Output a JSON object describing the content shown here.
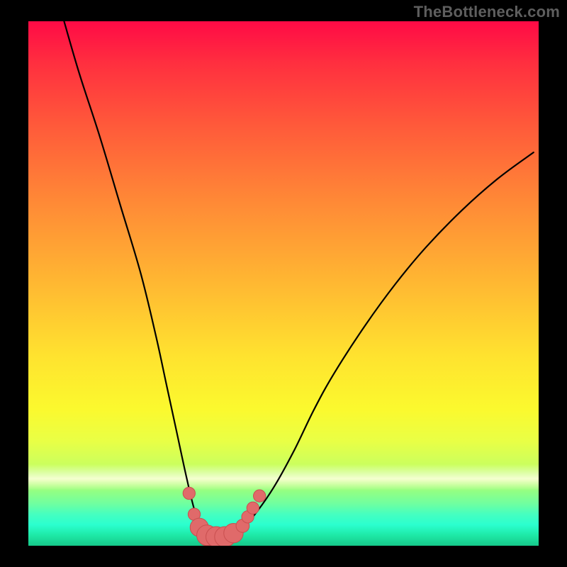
{
  "watermark": {
    "text": "TheBottleneck.com"
  },
  "colors": {
    "curve_stroke": "#000000",
    "marker_fill": "#e06a6a",
    "marker_stroke": "#c94f4f",
    "near_bottom_band": "#f5ffd0"
  },
  "chart_data": {
    "type": "line",
    "title": "",
    "xlabel": "",
    "ylabel": "",
    "xlim": [
      0,
      100
    ],
    "ylim": [
      0,
      100
    ],
    "grid": false,
    "legend": false,
    "series": [
      {
        "name": "bottleneck-curve",
        "x": [
          7,
          10,
          14,
          18,
          22,
          25,
          27,
          29,
          31,
          32.5,
          34,
          36,
          38.5,
          41,
          44,
          48,
          52,
          56,
          60,
          66,
          72,
          78,
          85,
          92,
          99
        ],
        "y": [
          100,
          90,
          78,
          65,
          52,
          40,
          31,
          22,
          13,
          7,
          3,
          1.5,
          1.5,
          2.5,
          5.5,
          11,
          18,
          26,
          33,
          42,
          50,
          57,
          64,
          70,
          75
        ]
      }
    ],
    "markers": [
      {
        "x": 31.5,
        "y": 10,
        "r": 1.2
      },
      {
        "x": 32.5,
        "y": 6,
        "r": 1.2
      },
      {
        "x": 33.5,
        "y": 3.5,
        "r": 1.8
      },
      {
        "x": 35,
        "y": 2,
        "r": 2.0
      },
      {
        "x": 36.8,
        "y": 1.7,
        "r": 2.0
      },
      {
        "x": 38.5,
        "y": 1.7,
        "r": 2.0
      },
      {
        "x": 40.2,
        "y": 2.4,
        "r": 1.9
      },
      {
        "x": 42,
        "y": 3.8,
        "r": 1.3
      },
      {
        "x": 43,
        "y": 5.5,
        "r": 1.2
      },
      {
        "x": 44,
        "y": 7.2,
        "r": 1.2
      },
      {
        "x": 45.3,
        "y": 9.5,
        "r": 1.2
      }
    ],
    "flat_bottom_band": {
      "x1": 33.5,
      "x2": 40.5,
      "y": 1.6,
      "thickness": 3.2
    }
  }
}
